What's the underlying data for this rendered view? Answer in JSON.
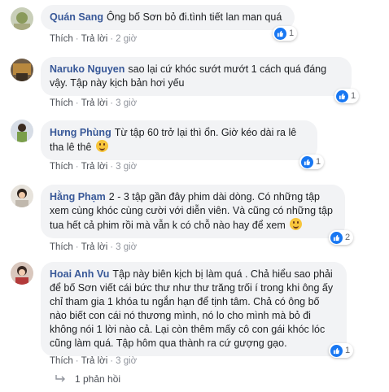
{
  "actions": {
    "like": "Thích",
    "reply": "Trả lời",
    "separator": "·"
  },
  "comments": [
    {
      "author": "Quán Sang",
      "text": "Ông bố Sơn bỏ đi.tình tiết lan man quá",
      "time": "2 giờ",
      "likes": "1",
      "emoji": false
    },
    {
      "author": "Naruko Nguyen",
      "text": "sao lại cứ khóc sướt mướt 1 cách quá đáng vậy. Tập này kịch bản hơi yếu",
      "time": "3 giờ",
      "likes": "1",
      "emoji": false
    },
    {
      "author": "Hưng Phùng",
      "text": "Từ tập 60 trở lại thì ổn. Giờ kéo dài ra lê tha lê thê",
      "time": "3 giờ",
      "likes": "1",
      "emoji": true
    },
    {
      "author": "Hằng Phạm",
      "text": "2 - 3 tập gần đây phim dài dòng. Có những tập xem cùng khóc cùng cười với diễn viên. Và cũng có những tập tua hết cả phim rồi mà vẫn k có chỗ nào hay để xem",
      "time": "3 giờ",
      "likes": "2",
      "emoji": true
    },
    {
      "author": "Hoai Anh Vu",
      "text": "Tập này biên kịch bị làm quá . Chả hiểu sao phải để bố Sơn viết cái bức thư như thư trăng trối í trong khi ông ấy chỉ tham gia 1 khóa tu ngắn hạn để tịnh tâm. Chả có ông bố nào biết con cái nó thương mình, nó lo cho mình mà bỏ đi không nói 1 lời nào cả. Lại còn thêm mấy cô con gái khóc lóc cũng làm quá. Tập hôm qua thành ra cứ gượng gạo.",
      "time": "3 giờ",
      "likes": "1",
      "emoji": false
    }
  ],
  "replies_link": "1 phản hồi",
  "colors": {
    "author": "#385898",
    "bubble": "#f2f3f5",
    "like": "#1877f2",
    "meta": "#90949c"
  }
}
